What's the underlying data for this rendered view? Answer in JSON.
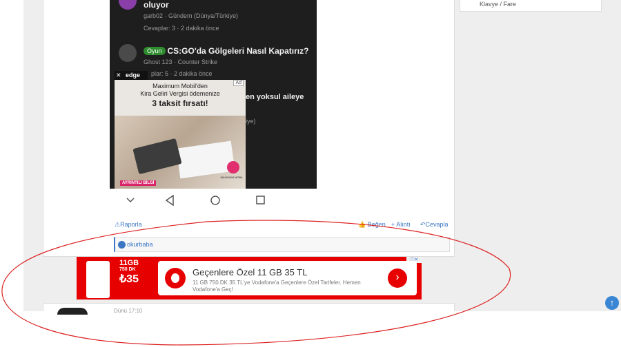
{
  "sidebar": {
    "item_label": "Klavye / Fare"
  },
  "screenshot": {
    "threads": [
      {
        "title": "oluyor",
        "meta": "garb02 · Gündem (Dünya/Türkiye)",
        "stats": "Cevaplar: 3 · 2 dakika önce"
      },
      {
        "prefix": "Oyun",
        "title": "CS:GO'da Gölgeleri Nasıl Kapatırız?",
        "meta": "Ghost 123 · Counter Strike",
        "stats": "plar: 5 · 2 dakika önce"
      }
    ],
    "partial_title": "en yoksul aileye",
    "partial_meta": "iye)",
    "edge_label": "edge",
    "ad": {
      "tag": "Ad",
      "line1": "Maximum Mobil'den",
      "line2": "Kira Geliri Vergisi ödemenize",
      "headline": "3 taksit fırsatı!",
      "button": "AYRINTILI BİLGİ",
      "brand": "MAXIMUM MOBİL"
    }
  },
  "actions": {
    "report": "Raporla",
    "like": "Beğen",
    "quote": "+ Alıntı",
    "reply": "Cevapla"
  },
  "liked_by": "okurbaba",
  "vodafone_ad": {
    "price_gb": "11GB",
    "price_dk": "750 DK",
    "price": "₺35",
    "title": "Geçenlere Özel 11 GB 35 TL",
    "description": "11 GB 750 DK 35 TL'ye Vodafone'a Geçenlere Özel Tarifeler. Hemen Vodafone'a Geç!"
  },
  "next_post": {
    "partial": "Dünü 17:10"
  },
  "colors": {
    "accent": "#3a76c4",
    "vodafone": "#e60000",
    "annotation": "#dd2222"
  },
  "icons": [
    "back-triangle-icon",
    "home-circle-icon",
    "recents-square-icon",
    "chevron-down-icon",
    "thumbs-up-icon",
    "warning-icon",
    "arrow-up-icon",
    "chevron-right-icon"
  ]
}
